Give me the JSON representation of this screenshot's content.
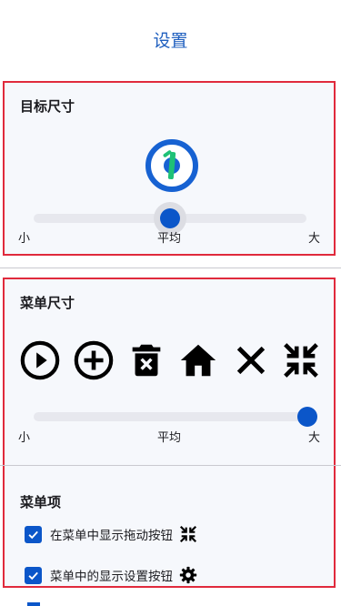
{
  "header": {
    "title": "设置"
  },
  "target_size": {
    "title": "目标尺寸",
    "slider": {
      "min_label": "小",
      "mid_label": "平均",
      "max_label": "大",
      "level": 0.5
    }
  },
  "menu_size": {
    "title": "菜单尺寸",
    "icons": [
      "play-circle-icon",
      "add-circle-icon",
      "delete-icon",
      "home-icon",
      "close-icon",
      "collapse-icon"
    ],
    "slider": {
      "min_label": "小",
      "mid_label": "平均",
      "max_label": "大",
      "level": 1.0
    }
  },
  "menu_items": {
    "title": "菜单项",
    "items": [
      {
        "label": "在菜单中显示拖动按钮",
        "checked": true,
        "icon": "drag-collapse-icon"
      },
      {
        "label": "菜单中的显示设置按钮",
        "checked": true,
        "icon": "gear-icon"
      }
    ]
  },
  "colors": {
    "accent": "#0b56c9",
    "title": "#1f5fbf",
    "highlight_border": "#e02a3c",
    "target_needle": "#1fc176"
  }
}
